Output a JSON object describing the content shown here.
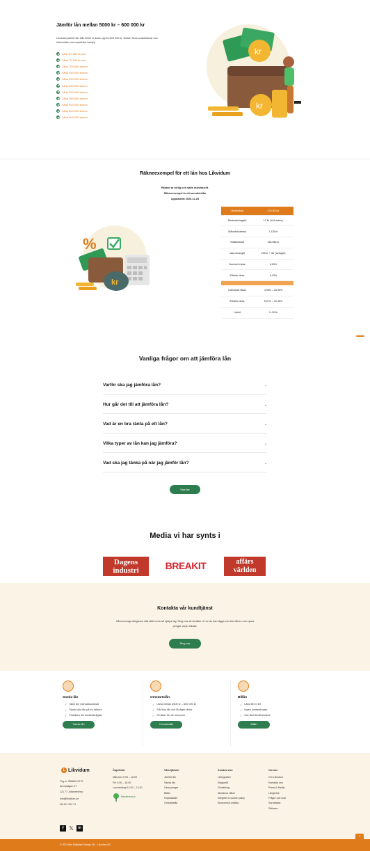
{
  "hero": {
    "title": "Jämför lån mellan 5000 kr – 600 000 kr",
    "intro": "Likvidum jämför lån från 5000 kr ända upp till 600 000 kr. Nedan finns snabblänkar och information om respektive belopp",
    "links": [
      "Låna 50 000 kronor",
      "Låna 70 000 kronor",
      "Låna 100 000 kronor",
      "Låna 150 000 kronor",
      "Låna 200 000 kronor",
      "Låna 250 000 kronor",
      "Låna 300 000 kronor",
      "Låna 350 000 kronor",
      "Låna 400 000 kronor",
      "Låna 500 000 kronor",
      "Låna 600 000 kronor"
    ],
    "illustration_icon": "wallet-money-person-illustration"
  },
  "example": {
    "title": "Räkneexempel för ett lån hos Likvidum",
    "note1": "Räntan är rörlig och sätts individuellt.",
    "note2": "Räkneexempel är ett annuitetslån",
    "note3": "uppdaterat 2023-11-28",
    "illustration_icon": "calculator-money-bag-illustration",
    "head": [
      "Lånebelopp",
      "100 000 kr"
    ],
    "rows": [
      [
        "Återbetalningstid",
        "12 år (144 avbet.)"
      ],
      [
        "Månadskostnad",
        "1 135 kr"
      ],
      [
        "Totalkostnad",
        "163 566 kr"
      ],
      [
        "start-/avavgift",
        "495 kr + 0kr (avavgift)"
      ],
      [
        "Nominell ränta",
        "8,95%"
      ],
      [
        "Effektiv ränta",
        "9,43%"
      ]
    ],
    "rows2": [
      [
        "Individuell ränta",
        "4,95% – 25,95%"
      ],
      [
        "Effektiv ränta",
        "5,07% – 31,45%"
      ],
      [
        "Löptid",
        "1–20 år"
      ]
    ]
  },
  "faq": {
    "title": "Vanliga frågor om att jämföra lån",
    "items": [
      "Varför ska jag jämföra lån?",
      "Hur går det till att jämföra lån?",
      "Vad är en bra ränta på ett lån?",
      "Vilka typer av lån kan jag jämföra?",
      "Vad ska jag tänka på när jag jämför lån?"
    ],
    "more_button": "Visa fler"
  },
  "media": {
    "title": "Media vi har synts i",
    "logos": [
      "Dagens industri",
      "BREAKIT",
      "affärs världen"
    ]
  },
  "contact": {
    "title": "Kontakta vår kundtjänst",
    "text": "Våra kunniga rådgivare står alltid redo att hjälpa dig. Ring oss så berättar vi hur du kan lägga om dina lånen och spara pengar varje månad.",
    "button": "Ring oss"
  },
  "services": [
    {
      "title": "Samla lån",
      "icon": "hands-coins-icon",
      "points": [
        "Sänk din månadskostnad",
        "Samla alla lån på en faktura",
        "Förbättra din kreditvärdighet"
      ],
      "button": "Samla lån"
    },
    {
      "title": "Omstartslån",
      "icon": "percent-coins-icon",
      "points": [
        "Låna mellan 5000 kr – 600 000 kr",
        "Slå ihop lån och få lägre ränta",
        "Omstart för din ekonomi"
      ],
      "button": "Omstartslån"
    },
    {
      "title": "Billån",
      "icon": "car-icon",
      "points": [
        "Låna till en bil",
        "Ingen kontantinsats",
        "Inte låst till bilhandlare"
      ],
      "button": "Billån"
    }
  ],
  "footer": {
    "brand": "Likvidum",
    "org": "Org.nr: 556849-5772",
    "address1": "Arenavägen 27",
    "address2": "121 77 Johanneshov",
    "email": "info@likvidum.se",
    "phone": "08-121 314 71",
    "hours_title": "Öppettider",
    "hours": [
      "Mån-tors 9.00 – 18.00",
      "Fre 9.00 – 16.00",
      "Lunchstängt 12.00 – 13.00"
    ],
    "climate_badge": "klimatneutral",
    "columns": [
      {
        "title": "Våra tjänster",
        "items": [
          "Jämför lån",
          "Samla lån",
          "Låna pengar",
          "Billån",
          "Hopbakslån",
          "Omstartslån"
        ]
      },
      {
        "title": "Kundservice",
        "items": [
          "Låneguiden",
          "Klagomål",
          "Försäkring",
          "Allmänna villkor",
          "Integritet & cookie policy",
          "Ekonomisk ordlista"
        ]
      },
      {
        "title": "Om oss",
        "items": [
          "Om Likvidum",
          "Kontakta oss",
          "Press & Media",
          "Långivare",
          "Frågor och svar",
          "Karriärsida",
          "Sidkarta"
        ]
      }
    ],
    "social": [
      "facebook-icon",
      "x-icon",
      "linkedin-icon"
    ],
    "copyright": "© 2024 Hav Möjlighet Sverige AB – Likvidum AB"
  },
  "colors": {
    "accent": "#e07b1c",
    "green": "#2e7d4f",
    "cream": "#fbf3e6"
  }
}
